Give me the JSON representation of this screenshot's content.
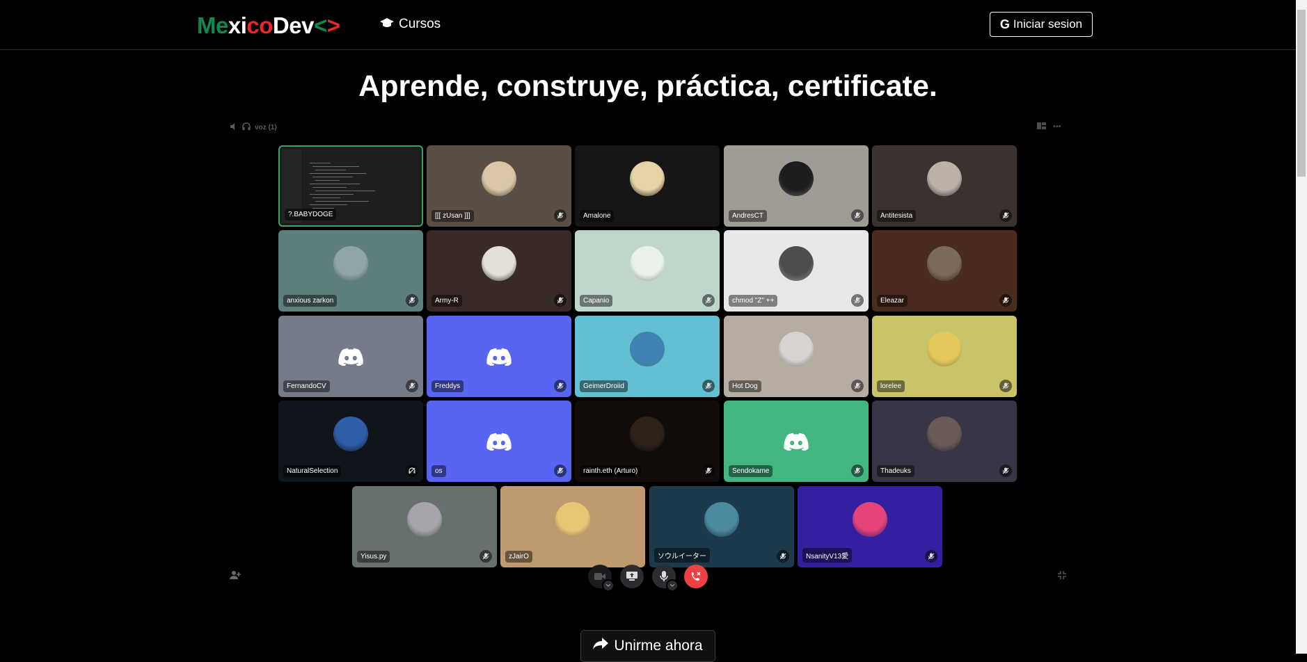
{
  "navbar": {
    "brand_parts": [
      {
        "text": "Me",
        "color": "#0e8a4f"
      },
      {
        "text": "xi",
        "color": "#ffffff"
      },
      {
        "text": "co",
        "color": "#e8282b"
      },
      {
        "text": "Dev",
        "color": "#ffffff"
      },
      {
        "text": "<",
        "color": "#0e8a4f"
      },
      {
        "text": ">",
        "color": "#e8282b"
      }
    ],
    "courses_link": "Cursos",
    "login_button": "Iniciar sesion"
  },
  "hero": {
    "title": "Aprende, construye, práctica, certificate."
  },
  "call": {
    "channel_label": "voz (1)",
    "participants": [
      {
        "name": "?.BABYDOGE",
        "bg": "#1b1b1b",
        "kind": "screen",
        "speaking": true
      },
      {
        "name": "[[[ zUsan ]]]",
        "bg": "#5a4e45",
        "kind": "avatar",
        "avatar": "#d9c7a7",
        "mute": "muted"
      },
      {
        "name": "Amalone",
        "bg": "#161616",
        "kind": "avatar",
        "avatar": "#e4d3a5"
      },
      {
        "name": "AndresCT",
        "bg": "#a09b94",
        "kind": "avatar",
        "avatar": "#1d1d1d",
        "mute": "muted"
      },
      {
        "name": "Antitesista",
        "bg": "#3a322f",
        "kind": "avatar",
        "avatar": "#bdb2a8",
        "mute": "muted"
      },
      {
        "name": "anxious zarkon",
        "bg": "#5f7f7f",
        "kind": "avatar",
        "avatar": "#8fa5a7",
        "mute": "muted"
      },
      {
        "name": "Army-R",
        "bg": "#3a2a27",
        "kind": "avatar",
        "avatar": "#e3e0da",
        "mute": "muted"
      },
      {
        "name": "Capanio",
        "bg": "#bfd6cb",
        "kind": "avatar",
        "avatar": "#eaf1ea",
        "mute": "muted"
      },
      {
        "name": "chmod \"Z\" ++",
        "bg": "#e9e7ea",
        "kind": "avatar",
        "avatar": "#4d4d4d",
        "mute": "muted"
      },
      {
        "name": "Eleazar",
        "bg": "#4a2b1f",
        "kind": "avatar",
        "avatar": "#7b6a5c",
        "mute": "muted"
      },
      {
        "name": "FernandoCV",
        "bg": "#757b89",
        "kind": "discord",
        "mute": "muted"
      },
      {
        "name": "Freddys",
        "bg": "#5865f2",
        "kind": "discord",
        "mute": "muted"
      },
      {
        "name": "GeimerDroiid",
        "bg": "#63bfd2",
        "kind": "avatar",
        "avatar": "#3f84b5",
        "mute": "muted"
      },
      {
        "name": "Hot Dog",
        "bg": "#b6aca2",
        "kind": "avatar",
        "avatar": "#d6d3d1",
        "mute": "muted"
      },
      {
        "name": "lorelee",
        "bg": "#c9c36a",
        "kind": "avatar",
        "avatar": "#e4c85a",
        "mute": "muted"
      },
      {
        "name": "NaturalSelection",
        "bg": "#10141b",
        "kind": "avatar",
        "avatar": "#2f5da8",
        "mute": "deafened"
      },
      {
        "name": "os",
        "bg": "#5865f2",
        "kind": "discord",
        "mute": "muted"
      },
      {
        "name": "rainth.eth (Arturo)",
        "bg": "#120d0b",
        "kind": "avatar",
        "avatar": "#2e2118",
        "mute": "muted"
      },
      {
        "name": "Sendokame",
        "bg": "#43b581",
        "kind": "discord-hat",
        "mute": "muted"
      },
      {
        "name": "Thadeuks",
        "bg": "#383546",
        "kind": "avatar",
        "avatar": "#6b5a55",
        "mute": "muted"
      },
      {
        "name": "Yisus.py",
        "bg": "#68706e",
        "kind": "avatar",
        "avatar": "#a4a6ab",
        "mute": "muted"
      },
      {
        "name": "zJairO",
        "bg": "#be9a6e",
        "kind": "avatar",
        "avatar": "#e9c673"
      },
      {
        "name": "ソウルイーター",
        "bg": "#1c3a4c",
        "kind": "avatar",
        "avatar": "#4b8aa0",
        "mute": "muted"
      },
      {
        "name": "NsanityV13愛",
        "bg": "#3220a0",
        "kind": "avatar",
        "avatar": "#e5437a",
        "mute": "muted"
      }
    ]
  },
  "join_button": "Unirme ahora",
  "colors": {
    "hangup": "#ed4245",
    "control": "#2b2d31",
    "speaking": "#3ba55d"
  }
}
